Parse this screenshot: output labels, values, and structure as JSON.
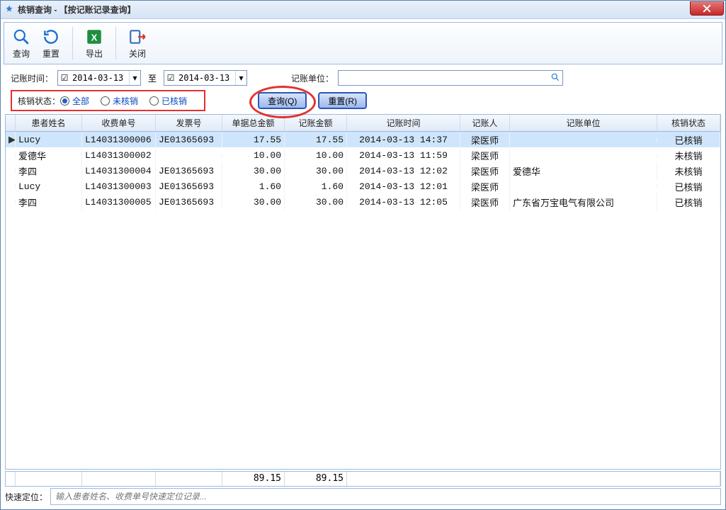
{
  "window": {
    "title": "核销查询 - 【按记账记录查询】"
  },
  "toolbar": {
    "query": "查询",
    "reset": "重置",
    "export": "导出",
    "close": "关闭"
  },
  "filter": {
    "time_label": "记账时间：",
    "between": "至",
    "date_from": "2014-03-13",
    "date_to": "2014-03-13",
    "unit_label": "记账单位：",
    "unit_value": ""
  },
  "status_filter": {
    "label": "核销状态：",
    "options": {
      "all": "全部",
      "unverified": "未核销",
      "verified": "已核销"
    },
    "selected": "all"
  },
  "buttons": {
    "query": "查询(Q)",
    "reset": "重置(R)"
  },
  "table": {
    "headers": {
      "name": "患者姓名",
      "bill_no": "收费单号",
      "invoice_no": "发票号",
      "total_amount": "单据总金额",
      "book_amount": "记账金额",
      "book_time": "记账时间",
      "book_person": "记账人",
      "book_unit": "记账单位",
      "status": "核销状态"
    },
    "rows": [
      {
        "ind": "▶",
        "name": "Lucy",
        "bill": "L14031300006",
        "inv": "JE01365693",
        "total": "17.55",
        "book": "17.55",
        "time": "2014-03-13 14:37",
        "person": "梁医师",
        "unit": "",
        "status": "已核销"
      },
      {
        "ind": "",
        "name": "爱德华",
        "bill": "L14031300002",
        "inv": "",
        "total": "10.00",
        "book": "10.00",
        "time": "2014-03-13 11:59",
        "person": "梁医师",
        "unit": "",
        "status": "未核销"
      },
      {
        "ind": "",
        "name": "李四",
        "bill": "L14031300004",
        "inv": "JE01365693",
        "total": "30.00",
        "book": "30.00",
        "time": "2014-03-13 12:02",
        "person": "梁医师",
        "unit": "爱德华",
        "status": "未核销"
      },
      {
        "ind": "",
        "name": "Lucy",
        "bill": "L14031300003",
        "inv": "JE01365693",
        "total": "1.60",
        "book": "1.60",
        "time": "2014-03-13 12:01",
        "person": "梁医师",
        "unit": "",
        "status": "已核销"
      },
      {
        "ind": "",
        "name": "李四",
        "bill": "L14031300005",
        "inv": "JE01365693",
        "total": "30.00",
        "book": "30.00",
        "time": "2014-03-13 12:05",
        "person": "梁医师",
        "unit": "广东省万宝电气有限公司",
        "status": "已核销"
      }
    ],
    "sums": {
      "total": "89.15",
      "book": "89.15"
    }
  },
  "quick": {
    "label": "快速定位：",
    "placeholder": "输入患者姓名、收费单号快速定位记录..."
  }
}
